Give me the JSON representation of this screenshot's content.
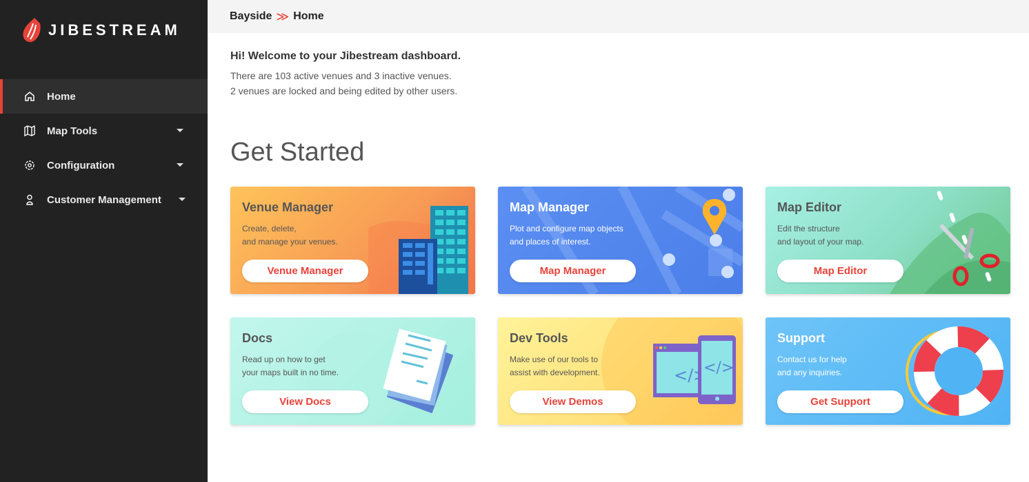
{
  "brand": {
    "name": "JIBESTREAM"
  },
  "sidebar": {
    "items": [
      {
        "label": "Home",
        "icon": "home-icon"
      },
      {
        "label": "Map Tools",
        "icon": "map-icon"
      },
      {
        "label": "Configuration",
        "icon": "gear-icon"
      },
      {
        "label": "Customer Management",
        "icon": "user-icon"
      }
    ]
  },
  "breadcrumb": {
    "parent": "Bayside",
    "separator": "≫",
    "current": "Home"
  },
  "welcome": {
    "title": "Hi! Welcome to your Jibestream dashboard.",
    "line1": "There are 103 active venues and 3 inactive venues.",
    "line2": "2 venues are locked and being edited by other users."
  },
  "section_title": "Get Started",
  "cards": [
    {
      "title": "Venue Manager",
      "desc1": "Create, delete,",
      "desc2": "and manage your venues.",
      "button": "Venue Manager"
    },
    {
      "title": "Map Manager",
      "desc1": "Plot and configure map objects",
      "desc2": "and places of interest.",
      "button": "Map Manager"
    },
    {
      "title": "Map Editor",
      "desc1": "Edit the structure",
      "desc2": "and layout of your map.",
      "button": "Map Editor"
    },
    {
      "title": "Docs",
      "desc1": "Read up on how to get",
      "desc2": "your maps built in no time.",
      "button": "View Docs"
    },
    {
      "title": "Dev Tools",
      "desc1": "Make use of our tools to",
      "desc2": "assist with development.",
      "button": "View Demos"
    },
    {
      "title": "Support",
      "desc1": "Contact us for help",
      "desc2": "and any inquiries.",
      "button": "Get Support"
    }
  ],
  "colors": {
    "accent": "#e8433a",
    "sidebar": "#222222"
  }
}
